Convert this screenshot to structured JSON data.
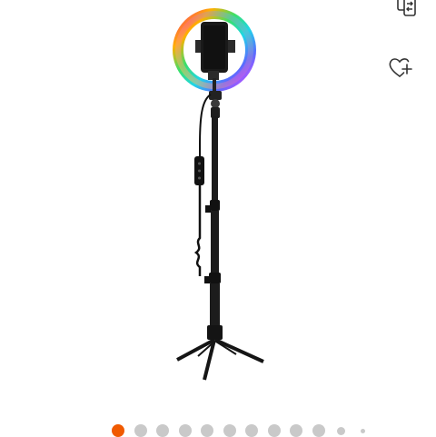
{
  "gallery": {
    "image_name": "rgb-ring-light-tripod-stand",
    "actions": [
      {
        "name": "compare",
        "icon": "compare-icon"
      },
      {
        "name": "wishlist",
        "icon": "heart-plus-icon"
      }
    ],
    "page_indicator": {
      "total": 12,
      "active_index": 0,
      "active_color": "#f05a00",
      "inactive_color": "#c9c9c9"
    }
  }
}
